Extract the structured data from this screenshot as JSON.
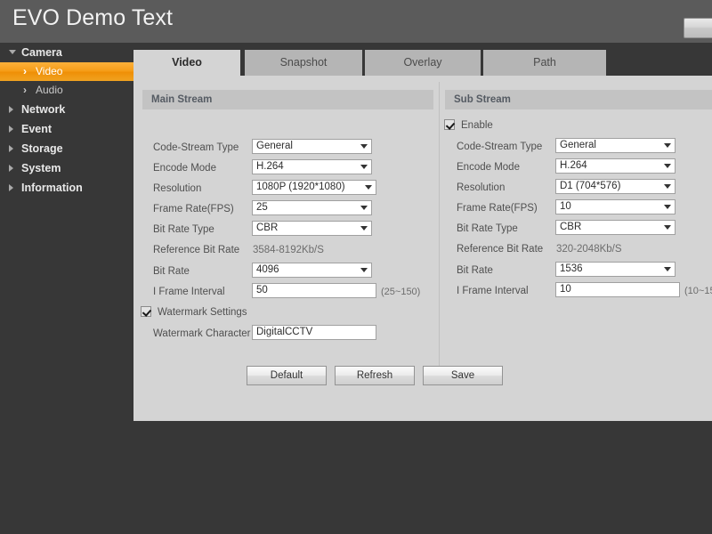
{
  "header": {
    "title": "EVO Demo Text",
    "logout_label": ""
  },
  "sidebar": {
    "groups": [
      {
        "label": "Camera",
        "expanded": true,
        "children": [
          {
            "label": "Video",
            "active": true
          },
          {
            "label": "Audio",
            "active": false
          }
        ]
      },
      {
        "label": "Network",
        "expanded": false,
        "children": []
      },
      {
        "label": "Event",
        "expanded": false,
        "children": []
      },
      {
        "label": "Storage",
        "expanded": false,
        "children": []
      },
      {
        "label": "System",
        "expanded": false,
        "children": []
      },
      {
        "label": "Information",
        "expanded": false,
        "children": []
      }
    ]
  },
  "tabs": [
    {
      "label": "Video",
      "active": true
    },
    {
      "label": "Snapshot",
      "active": false
    },
    {
      "label": "Overlay",
      "active": false
    },
    {
      "label": "Path",
      "active": false
    }
  ],
  "main_stream": {
    "section_title": "Main Stream",
    "fields": {
      "code_stream_type_label": "Code-Stream Type",
      "code_stream_type_value": "General",
      "encode_mode_label": "Encode Mode",
      "encode_mode_value": "H.264",
      "resolution_label": "Resolution",
      "resolution_value": "1080P (1920*1080)",
      "frame_rate_label": "Frame Rate(FPS)",
      "frame_rate_value": "25",
      "bit_rate_type_label": "Bit Rate Type",
      "bit_rate_type_value": "CBR",
      "reference_bit_rate_label": "Reference Bit Rate",
      "reference_bit_rate_value": "3584-8192Kb/S",
      "bit_rate_label": "Bit Rate",
      "bit_rate_value": "4096",
      "i_frame_interval_label": "I Frame Interval",
      "i_frame_interval_value": "50",
      "i_frame_interval_hint": "(25~150)",
      "watermark_settings_label": "Watermark Settings",
      "watermark_character_label": "Watermark Character",
      "watermark_character_value": "DigitalCCTV"
    }
  },
  "sub_stream": {
    "section_title": "Sub Stream",
    "enable_label": "Enable",
    "fields": {
      "code_stream_type_label": "Code-Stream Type",
      "code_stream_type_value": "General",
      "encode_mode_label": "Encode Mode",
      "encode_mode_value": "H.264",
      "resolution_label": "Resolution",
      "resolution_value": "D1 (704*576)",
      "frame_rate_label": "Frame Rate(FPS)",
      "frame_rate_value": "10",
      "bit_rate_type_label": "Bit Rate Type",
      "bit_rate_type_value": "CBR",
      "reference_bit_rate_label": "Reference Bit Rate",
      "reference_bit_rate_value": "320-2048Kb/S",
      "bit_rate_label": "Bit Rate",
      "bit_rate_value": "1536",
      "i_frame_interval_label": "I Frame Interval",
      "i_frame_interval_value": "10",
      "i_frame_interval_hint": "(10~15"
    }
  },
  "buttons": {
    "default_label": "Default",
    "refresh_label": "Refresh",
    "save_label": "Save"
  },
  "colors": {
    "accent": "#f59c17",
    "header_bg": "#5b5b5b",
    "sidebar_bg": "#373737",
    "panel_bg": "#d4d4d4",
    "section_bar_bg": "#c3c3c3"
  }
}
